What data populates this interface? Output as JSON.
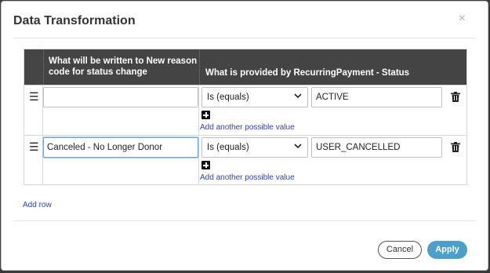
{
  "dialog": {
    "title": "Data Transformation",
    "close_label": "×"
  },
  "table": {
    "headers": [
      "What will be written to New reason code for status change",
      "What is provided by RecurringPayment - Status"
    ],
    "rows": [
      {
        "text_value": "",
        "operator": "Is (equals)",
        "match_value": "ACTIVE",
        "add_value_label": "Add another possible value"
      },
      {
        "text_value": "Canceled - No Longer Donor",
        "operator": "Is (equals)",
        "match_value": "USER_CANCELLED",
        "add_value_label": "Add another possible value"
      }
    ],
    "drag_glyph": "☰"
  },
  "add_row_label": "Add row",
  "footer": {
    "cancel_label": "Cancel",
    "apply_label": "Apply"
  },
  "colors": {
    "header_bg": "#444444",
    "accent": "#4aa0c8",
    "link": "#2a3fbf"
  },
  "icons": {
    "drag": "drag-handle-icon",
    "trash": "trash-icon",
    "plus": "plus-square-icon",
    "chevron": "chevron-down-icon",
    "close": "close-icon"
  }
}
